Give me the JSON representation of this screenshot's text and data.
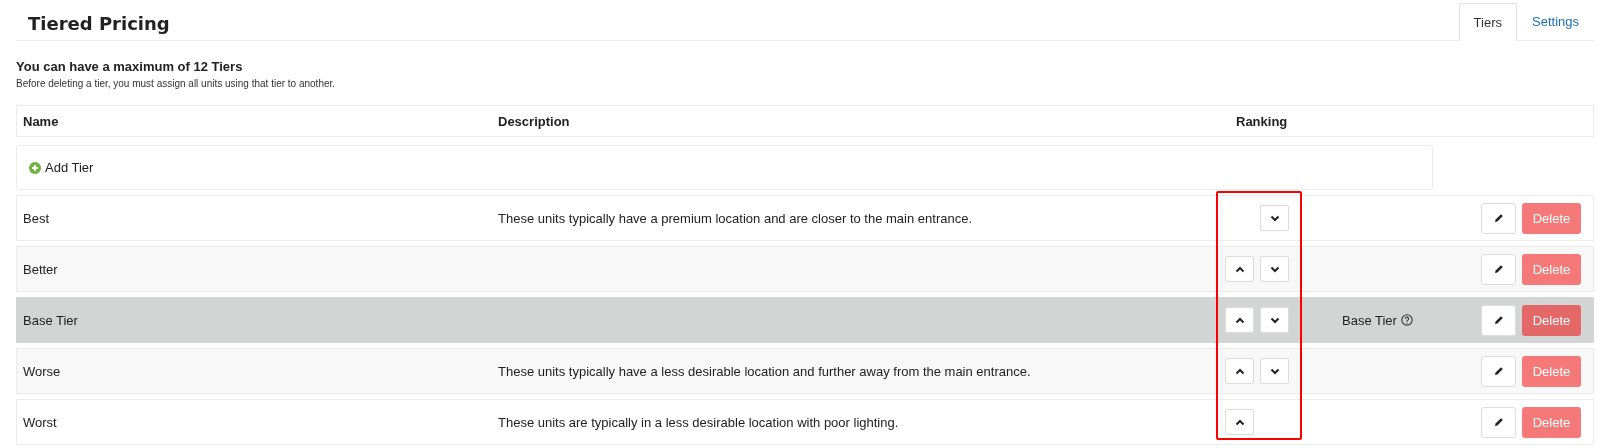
{
  "page": {
    "title": "Tiered Pricing"
  },
  "tabs": [
    {
      "label": "Tiers",
      "selected": true
    },
    {
      "label": "Settings",
      "selected": false
    }
  ],
  "notice": {
    "heading": "You can have a maximum of 12 Tiers",
    "text": "Before deleting a tier, you must assign all units using that tier to another."
  },
  "table": {
    "columns": [
      "Name",
      "Description",
      "Ranking"
    ],
    "add_button": "Add Tier",
    "ranking_highlighted": true,
    "rows": [
      {
        "name": "Best",
        "description": "These units typically have a premium location and are closer to the main entrance.",
        "can_move_up": false,
        "can_move_down": true,
        "base": false,
        "delete": "Delete"
      },
      {
        "name": "Better",
        "can_move_up": true,
        "can_move_down": true,
        "base": false,
        "delete": "Delete"
      },
      {
        "name": "Base Tier",
        "can_move_up": true,
        "can_move_down": true,
        "base": true,
        "base_label": "Base Tier",
        "delete": "Delete"
      },
      {
        "name": "Worse",
        "description": "These units typically have a less desirable location and further away from the main entrance.",
        "can_move_up": true,
        "can_move_down": true,
        "base": false,
        "delete": "Delete"
      },
      {
        "name": "Worst",
        "description": "These units are typically in a less desirable location with poor lighting.",
        "can_move_up": true,
        "can_move_down": false,
        "base": false,
        "delete": "Delete"
      }
    ]
  }
}
